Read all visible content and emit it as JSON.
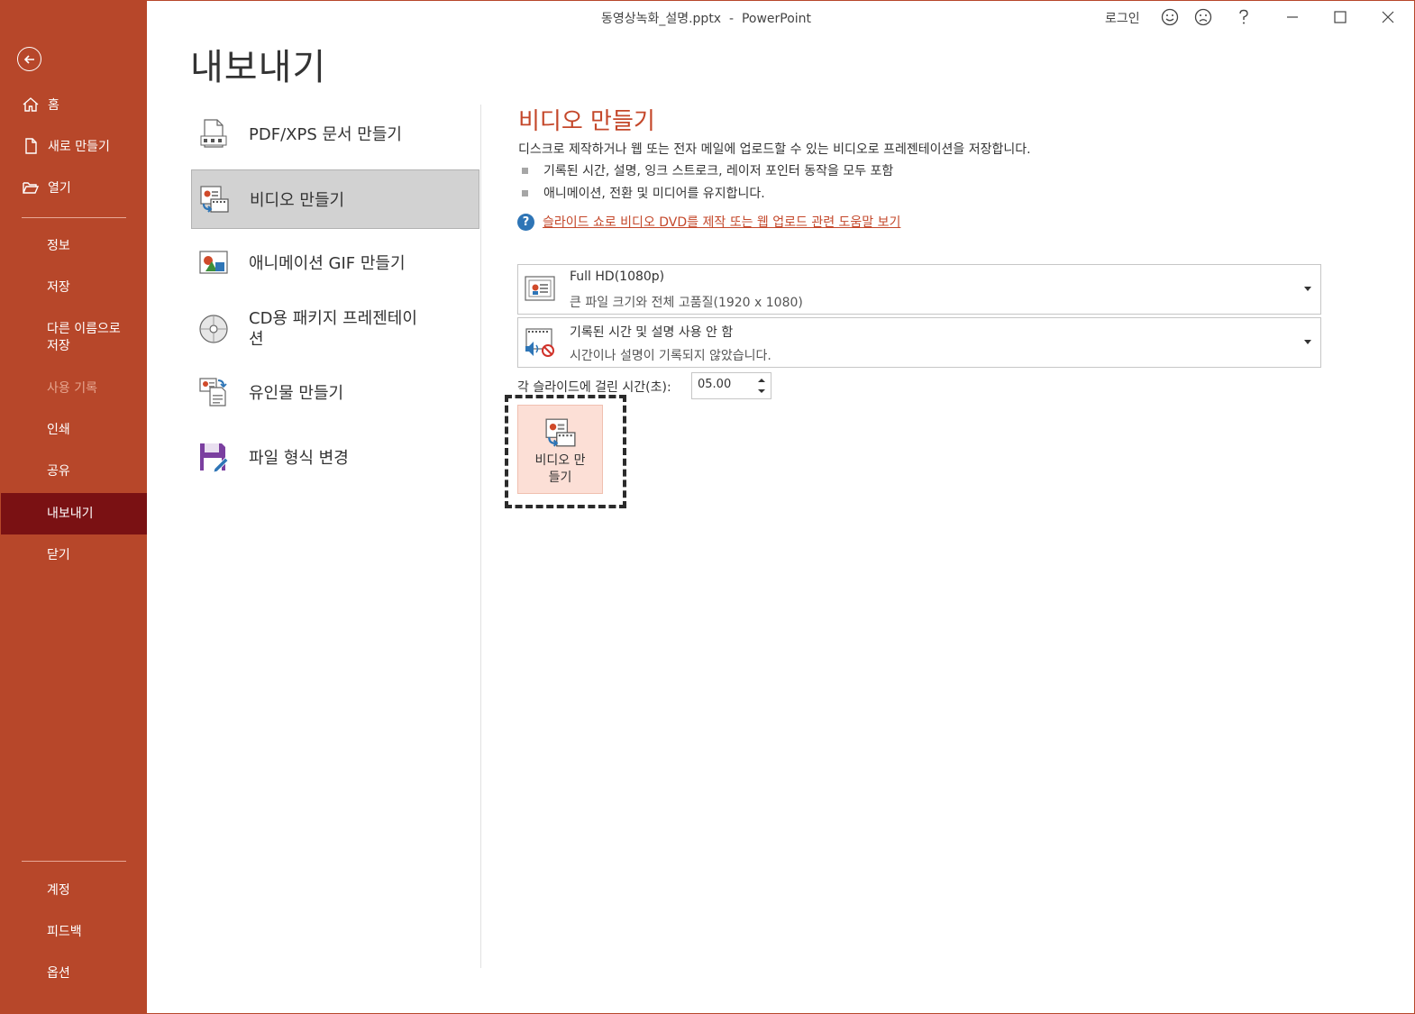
{
  "window": {
    "title": "동영상녹화_설명.pptx  -  PowerPoint",
    "login": "로그인",
    "icons": [
      "smiley-icon",
      "frown-icon",
      "help-icon",
      "minimize-icon",
      "maximize-icon",
      "close-icon"
    ]
  },
  "sidebar": {
    "top_items": [
      {
        "label": "홈",
        "icon": "home-icon"
      },
      {
        "label": "새로 만들기",
        "icon": "new-document-icon"
      },
      {
        "label": "열기",
        "icon": "open-folder-icon"
      }
    ],
    "items": [
      {
        "label": "정보"
      },
      {
        "label": "저장"
      },
      {
        "label": "다른 이름으로 저장"
      },
      {
        "label": "사용 기록",
        "disabled": true
      },
      {
        "label": "인쇄"
      },
      {
        "label": "공유"
      },
      {
        "label": "내보내기",
        "active": true
      },
      {
        "label": "닫기"
      }
    ],
    "bottom_items": [
      {
        "label": "계정"
      },
      {
        "label": "피드백"
      },
      {
        "label": "옵션"
      }
    ],
    "colors": {
      "background": "#b7472a",
      "active": "#7a1113"
    }
  },
  "page": {
    "title": "내보내기"
  },
  "export_options": [
    {
      "label": "PDF/XPS 문서 만들기",
      "icon": "pdf-document-icon"
    },
    {
      "label": "비디오 만들기",
      "icon": "video-icon",
      "selected": true
    },
    {
      "label": "애니메이션 GIF 만들기",
      "icon": "gif-image-icon"
    },
    {
      "label": "CD용 패키지 프레젠테이션",
      "icon": "cd-disc-icon"
    },
    {
      "label": "유인물 만들기",
      "icon": "handout-icon"
    },
    {
      "label": "파일 형식 변경",
      "icon": "save-format-icon"
    }
  ],
  "detail": {
    "title": "비디오 만들기",
    "description": "디스크로 제작하거나 웹 또는 전자 메일에 업로드할 수 있는 비디오로 프레젠테이션을 저장합니다.",
    "bullets": [
      "기록된 시간, 설명, 잉크 스트로크, 레이저 포인터 동작을 모두 포함",
      "애니메이션, 전환 및 미디어를 유지합니다."
    ],
    "help_link": "슬라이드 쇼로 비디오 DVD를 제작 또는 웹 업로드 관련 도움말 보기",
    "quality_dropdown": {
      "main": "Full HD(1080p)",
      "sub": "큰 파일 크기와 전체 고품질(1920 x 1080)"
    },
    "timing_dropdown": {
      "main": "기록된 시간 및 설명 사용 안 함",
      "sub": "시간이나 설명이 기록되지 않았습니다."
    },
    "seconds_label": "각 슬라이드에 걸린 시간(초):",
    "seconds_value": "05.00",
    "create_button": "비디오 만들기",
    "accent": "#c4472a"
  }
}
